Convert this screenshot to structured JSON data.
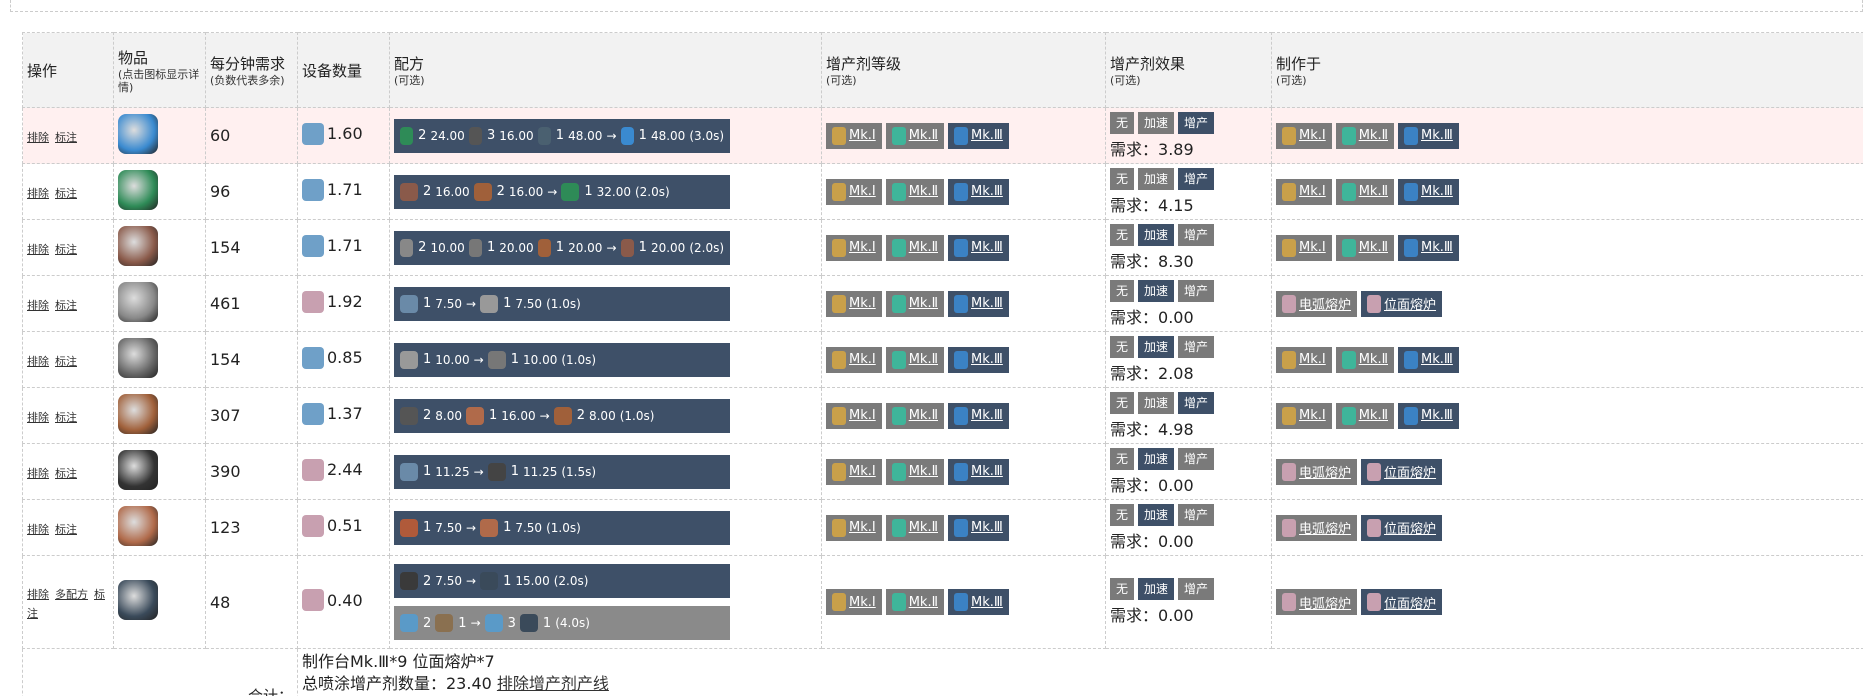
{
  "headers": {
    "ops": "操作",
    "item": "物品",
    "item_sub": "(点击图标显示详情)",
    "demand": "每分钟需求",
    "demand_sub": "(负数代表多余)",
    "devices": "设备数量",
    "recipe": "配方",
    "recipe_sub": "(可选)",
    "level": "增产剂等级",
    "level_sub": "(可选)",
    "effect": "增产剂效果",
    "effect_sub": "(可选)",
    "made": "制作于",
    "made_sub": "(可选)"
  },
  "labels": {
    "remove": "排除",
    "mark": "标注",
    "multi": "多配方",
    "mk1": "Mk.Ⅰ",
    "mk2": "Mk.Ⅱ",
    "mk3": "Mk.Ⅲ",
    "none": "无",
    "speed": "加速",
    "extra": "增产",
    "need_prefix": "需求：",
    "arc": "电弧熔炉",
    "plane": "位面熔炉",
    "arrow": "→",
    "total_label": "合计：",
    "total_line1": "制作台Mk.Ⅲ*9 位面熔炉*7",
    "total_line2": "总喷涂增产剂数量：23.40",
    "total_link": "排除增产剂产线"
  },
  "icon_colors": {
    "assembler": "#6fa0c8",
    "smelter": "#c8a0b0",
    "mk1": "#c9a04a",
    "mk2": "#3fb59a",
    "mk3": "#3b82c4"
  },
  "rows": [
    {
      "demand": "60",
      "devices": "1.60",
      "dev_icon": "assembler",
      "item_color": "#3a8ad0",
      "highlight": true,
      "inputs": [
        {
          "n": "2",
          "r": "24.00",
          "c": "#2e8b57"
        },
        {
          "n": "3",
          "r": "16.00",
          "c": "#555"
        },
        {
          "n": "1",
          "r": "48.00",
          "c": "#4a6070"
        }
      ],
      "outputs": [
        {
          "n": "1",
          "r": "48.00",
          "c": "#3a8ad0"
        }
      ],
      "time": "(3.0s)",
      "effect": "extra",
      "need": "3.89",
      "made": "assembler"
    },
    {
      "demand": "96",
      "devices": "1.71",
      "dev_icon": "assembler",
      "item_color": "#2e8b57",
      "inputs": [
        {
          "n": "2",
          "r": "16.00",
          "c": "#8a5a4a"
        },
        {
          "n": "2",
          "r": "16.00",
          "c": "#a0603a"
        }
      ],
      "outputs": [
        {
          "n": "1",
          "r": "32.00",
          "c": "#2e8b57"
        }
      ],
      "time": "(2.0s)",
      "effect": "extra",
      "need": "4.15",
      "made": "assembler"
    },
    {
      "demand": "154",
      "devices": "1.71",
      "dev_icon": "assembler",
      "item_color": "#8a5a4a",
      "inputs": [
        {
          "n": "2",
          "r": "10.00",
          "c": "#888"
        },
        {
          "n": "1",
          "r": "20.00",
          "c": "#777"
        },
        {
          "n": "1",
          "r": "20.00",
          "c": "#a0603a"
        }
      ],
      "outputs": [
        {
          "n": "1",
          "r": "20.00",
          "c": "#8a5a4a"
        }
      ],
      "time": "(2.0s)",
      "effect": "speed",
      "need": "8.30",
      "made": "assembler"
    },
    {
      "demand": "461",
      "devices": "1.92",
      "dev_icon": "smelter",
      "item_color": "#888",
      "inputs": [
        {
          "n": "1",
          "r": "7.50",
          "c": "#6a8aa8"
        }
      ],
      "outputs": [
        {
          "n": "1",
          "r": "7.50",
          "c": "#999"
        }
      ],
      "time": "(1.0s)",
      "effect": "speed",
      "need": "0.00",
      "made": "smelter"
    },
    {
      "demand": "154",
      "devices": "0.85",
      "dev_icon": "assembler",
      "item_color": "#666",
      "inputs": [
        {
          "n": "1",
          "r": "10.00",
          "c": "#999"
        }
      ],
      "outputs": [
        {
          "n": "1",
          "r": "10.00",
          "c": "#777"
        }
      ],
      "time": "(1.0s)",
      "effect": "speed",
      "need": "2.08",
      "made": "assembler"
    },
    {
      "demand": "307",
      "devices": "1.37",
      "dev_icon": "assembler",
      "item_color": "#a0603a",
      "inputs": [
        {
          "n": "2",
          "r": "8.00",
          "c": "#555"
        },
        {
          "n": "1",
          "r": "16.00",
          "c": "#b06a4a"
        }
      ],
      "outputs": [
        {
          "n": "2",
          "r": "8.00",
          "c": "#a0603a"
        }
      ],
      "time": "(1.0s)",
      "effect": "extra",
      "need": "4.98",
      "made": "assembler"
    },
    {
      "demand": "390",
      "devices": "2.44",
      "dev_icon": "smelter",
      "item_color": "#333",
      "inputs": [
        {
          "n": "1",
          "r": "11.25",
          "c": "#6a8aa8"
        }
      ],
      "outputs": [
        {
          "n": "1",
          "r": "11.25",
          "c": "#444"
        }
      ],
      "time": "(1.5s)",
      "effect": "speed",
      "need": "0.00",
      "made": "smelter"
    },
    {
      "demand": "123",
      "devices": "0.51",
      "dev_icon": "smelter",
      "item_color": "#b06a4a",
      "inputs": [
        {
          "n": "1",
          "r": "7.50",
          "c": "#b05a3a"
        }
      ],
      "outputs": [
        {
          "n": "1",
          "r": "7.50",
          "c": "#b06a4a"
        }
      ],
      "time": "(1.0s)",
      "effect": "speed",
      "need": "0.00",
      "made": "smelter"
    },
    {
      "demand": "48",
      "devices": "0.40",
      "dev_icon": "smelter",
      "item_color": "#3a4a5a",
      "multi": true,
      "inputs": [
        {
          "n": "2",
          "r": "7.50",
          "c": "#3a3a3a"
        }
      ],
      "outputs": [
        {
          "n": "1",
          "r": "15.00",
          "c": "#3a4a5a"
        }
      ],
      "time": "(2.0s)",
      "alt": {
        "inputs": [
          {
            "n": "2",
            "r": "",
            "c": "#5a9ac8"
          },
          {
            "n": "1",
            "r": "",
            "c": "#8a7050"
          }
        ],
        "outputs": [
          {
            "n": "3",
            "r": "",
            "c": "#5a9ac8"
          },
          {
            "n": "1",
            "r": "",
            "c": "#3a4a5a"
          }
        ],
        "time": "(4.0s)"
      },
      "effect": "speed",
      "need": "0.00",
      "made": "smelter"
    }
  ]
}
